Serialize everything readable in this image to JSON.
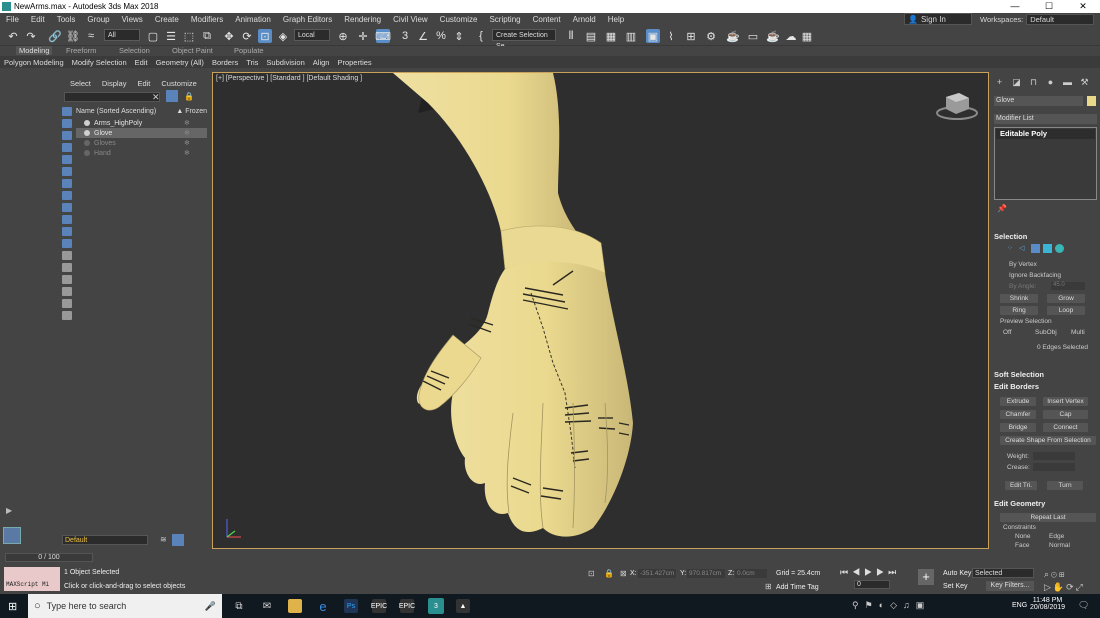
{
  "window": {
    "title": "NewArms.max - Autodesk 3ds Max 2018",
    "controls": [
      "—",
      "☐",
      "✕"
    ]
  },
  "menu": [
    "File",
    "Edit",
    "Tools",
    "Group",
    "Views",
    "Create",
    "Modifiers",
    "Animation",
    "Graph Editors",
    "Rendering",
    "Civil View",
    "Customize",
    "Scripting",
    "Content",
    "Arnold",
    "Help"
  ],
  "account": {
    "signin": "Sign In",
    "workspaces_label": "Workspaces:",
    "workspace": "Default"
  },
  "toolbar": {
    "filter": "All",
    "ref_coord": "Local",
    "named_selection": "Create Selection Se"
  },
  "ribbon": {
    "tabs": [
      "Modeling",
      "Freeform",
      "Selection",
      "Object Paint",
      "Populate"
    ],
    "items": [
      "Polygon Modeling",
      "Modify Selection",
      "Edit",
      "Geometry (All)",
      "Borders",
      "Tris",
      "Subdivision",
      "Align",
      "Properties"
    ]
  },
  "scene_explorer": {
    "tabs": [
      "Select",
      "Display",
      "Edit",
      "Customize"
    ],
    "col_name": "Name (Sorted Ascending)",
    "col_frozen": "▲ Frozen",
    "rows": [
      {
        "name": "Arms_HighPoly"
      },
      {
        "name": "Glove"
      },
      {
        "name": "Gloves"
      },
      {
        "name": "Hand"
      }
    ],
    "layer": "Default"
  },
  "viewport": {
    "label": "[+] [Perspective ] [Standard ] [Default Shading ]"
  },
  "command_panel": {
    "object_name": "Glove",
    "object_color": "#e8d98a",
    "modifier_list": "Modifier List",
    "stack": [
      "Editable Poly"
    ],
    "selection": {
      "title": "Selection",
      "by_vertex": "By Vertex",
      "ignore_backfacing": "Ignore Backfacing",
      "by_angle": "By Angle:",
      "angle_value": "45.0",
      "shrink": "Shrink",
      "grow": "Grow",
      "ring": "Ring",
      "loop": "Loop",
      "preview": "Preview Selection",
      "off": "Off",
      "subobj": "SubObj",
      "multi": "Multi",
      "status": "0 Edges Selected"
    },
    "soft_selection": "Soft Selection",
    "edit_borders": {
      "title": "Edit Borders",
      "extrude": "Extrude",
      "insert_vertex": "Insert Vertex",
      "chamfer": "Chamfer",
      "cap": "Cap",
      "bridge": "Bridge",
      "connect": "Connect",
      "create_shape": "Create Shape From Selection",
      "weight": "Weight:",
      "crease": "Crease:",
      "edit_tri": "Edit Tri.",
      "turn": "Turn"
    },
    "edit_geometry": {
      "title": "Edit Geometry",
      "repeat_last": "Repeat Last",
      "constraints": "Constraints",
      "none": "None",
      "edge": "Edge",
      "face": "Face",
      "normal": "Normal"
    }
  },
  "bottom": {
    "frame": "0 / 100",
    "maxscript": "MAXScript Mi",
    "status1": "1 Object Selected",
    "status2": "Click or click-and-drag to select objects",
    "x_label": "X:",
    "x_value": "-351.427cm",
    "y_label": "Y:",
    "y_value": "970.817cm",
    "z_label": "Z:",
    "z_value": "0.0cm",
    "grid": "Grid = 25.4cm",
    "add_time_tag": "Add Time Tag",
    "auto_key": "Auto Key",
    "set_key": "Set Key",
    "key_mode": "Selected",
    "key_filters": "Key Filters...",
    "frame_value": "0"
  },
  "taskbar": {
    "search": "Type here to search",
    "lang": "ENG",
    "time": "11:48 PM",
    "date": "20/08/2019"
  }
}
